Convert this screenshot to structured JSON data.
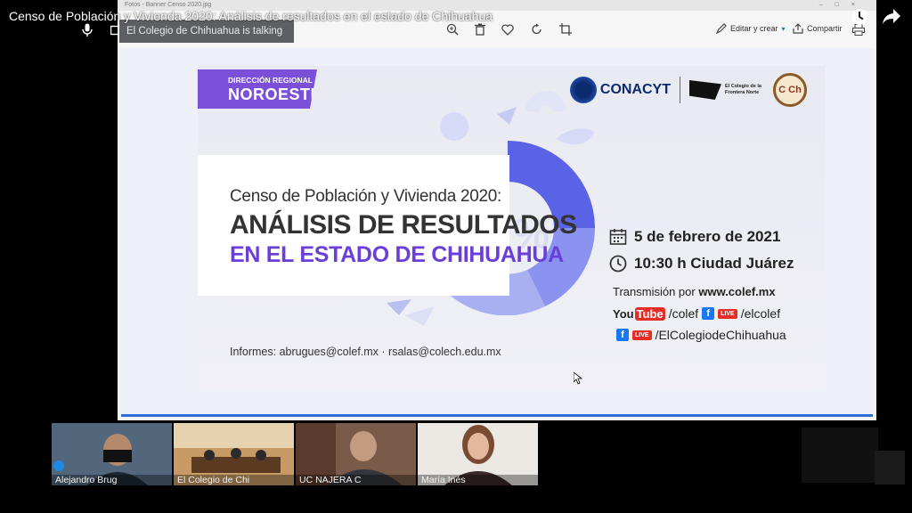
{
  "video": {
    "title": "Censo de Población y Vivienda 2020: Análisis de resultados en el estado de Chihuahua",
    "watch_later_icon": "clock-icon",
    "share_icon": "share-arrow-icon"
  },
  "meeting": {
    "speaker_notice": "El Colegio de Chihuahua is talking",
    "participants": [
      {
        "name": "Alejandro Brug"
      },
      {
        "name": "El Colegio de Chi"
      },
      {
        "name": "UC NAJERA C"
      },
      {
        "name": "María Inés"
      }
    ]
  },
  "viewer": {
    "title_text": "Fotos - Banner Censo 2020.jpg",
    "toolbar": {
      "edit_label": "Editar y crear",
      "share_label": "Compartir"
    }
  },
  "banner": {
    "badge_line1": "DIRECCIÓN REGIONAL",
    "badge_line2": "NOROESTE",
    "logo_conacyt": "CONACYT",
    "logo_colef": "El Colegio de la Frontera Norte",
    "seal_text": "C Ch",
    "title_line1": "Censo de Población y Vivienda 2020:",
    "title_line2": "ANÁLISIS DE RESULTADOS",
    "title_line3": "EN EL ESTADO DE CHIHUAHUA",
    "date": "5 de febrero de 2021",
    "time": "10:30 h Ciudad Juárez",
    "transmission_prefix": "Transmisión por",
    "transmission_site": "www.colef.mx",
    "youtube_you": "You",
    "youtube_tube": "Tube",
    "youtube_handle": "/colef",
    "live_label": "LIVE",
    "facebook_handle_1": "/elcolef",
    "facebook_handle_2": "/ElColegiodeChihuahua",
    "informes": "Informes: abrugues@colef.mx · rsalas@colech.edu.mx"
  },
  "colors": {
    "accent_purple": "#6c3ed8",
    "badge_purple": "#7b4fd8",
    "donut_blue": "#5a62e6",
    "youtube_red": "#e52d27",
    "facebook_blue": "#1877f2",
    "viewer_border_blue": "#2c6fd4"
  }
}
